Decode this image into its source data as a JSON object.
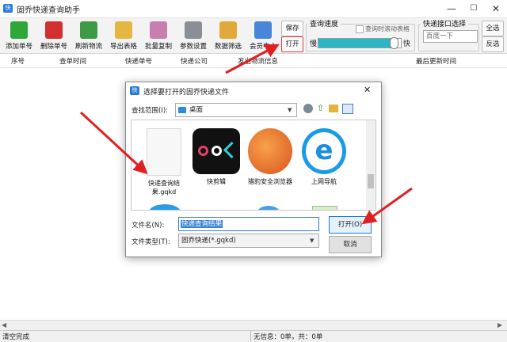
{
  "window": {
    "title": "固乔快递查询助手",
    "app_icon": "快",
    "minimize": "—",
    "maximize": "☐",
    "close": "✕"
  },
  "toolbar": {
    "buttons": [
      {
        "label": "添加单号",
        "icon": "plus-icon",
        "color": "#2fa63a"
      },
      {
        "label": "删除单号",
        "icon": "delete-x-icon",
        "color": "#d22f2f"
      },
      {
        "label": "刷新物流",
        "icon": "refresh-icon",
        "color": "#3d9a46"
      },
      {
        "label": "导出表格",
        "icon": "export-folder-icon",
        "color": "#e5b640"
      },
      {
        "label": "批量复制",
        "icon": "copy-icon",
        "color": "#c77fb0"
      },
      {
        "label": "参数设置",
        "icon": "gear-icon",
        "color": "#8a8f96"
      },
      {
        "label": "数据筛选",
        "icon": "filter-icon",
        "color": "#e0a93a"
      },
      {
        "label": "会员中心",
        "icon": "member-icon",
        "color": "#4a86d8"
      }
    ],
    "save_label": "保存",
    "open_label": "打开",
    "speed": {
      "label": "查询速度",
      "checkbox_label": "查询时滚动表格",
      "slow": "慢",
      "fast": "快",
      "value_percent": 92
    },
    "api": {
      "label": "快递接口选择",
      "selected": "百度一下",
      "all_label": "全选",
      "invert_label": "反选"
    }
  },
  "grid": {
    "columns": [
      "序号",
      "查单时间",
      "快递单号",
      "快递公司",
      "发出物流信息",
      "最后更新时间"
    ]
  },
  "dialog": {
    "title": "选择要打开的固乔快递文件",
    "lookin_label": "查找范围(I):",
    "lookin_value": "桌面",
    "files": [
      {
        "name": "快递查询结果.gqkd",
        "icon": "document-file-icon"
      },
      {
        "name": "快剪辑",
        "icon": "kuaijianji-app-icon"
      },
      {
        "name": "猎豹安全浏览器",
        "icon": "cheetah-browser-icon"
      },
      {
        "name": "上网导航",
        "icon": "ie-browser-icon"
      }
    ],
    "filename_label": "文件名(N):",
    "filename_value": "快递查询结果",
    "filetype_label": "文件类型(T):",
    "filetype_value": "固乔快递(*.gqkd)",
    "open_button": "打开(O)",
    "cancel_button": "取消",
    "close": "✕"
  },
  "status": {
    "left": "清空完成",
    "right": "无信息：0单，共：0单"
  },
  "colors": {
    "accent": "#1e78d7",
    "arrow": "#e02020"
  }
}
